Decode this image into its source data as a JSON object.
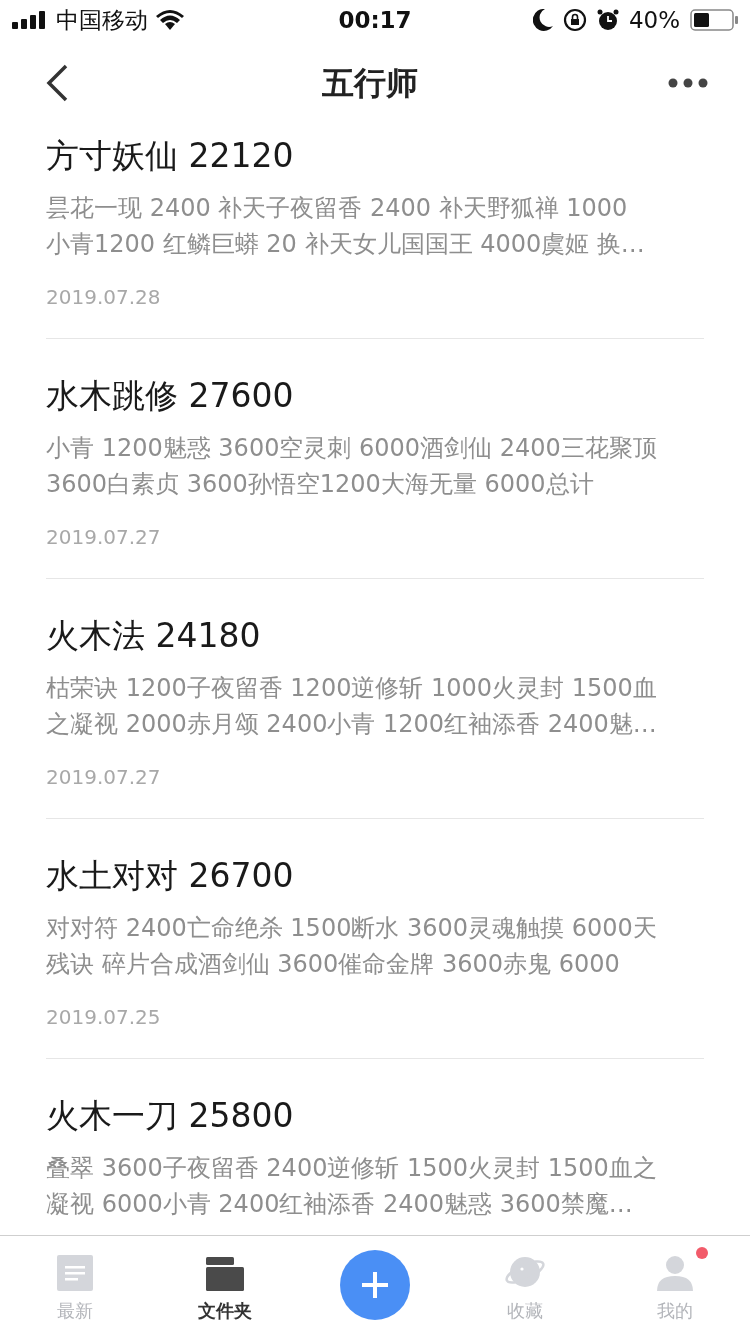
{
  "status_bar": {
    "carrier": "中国移动",
    "time": "00:17",
    "battery": "40%"
  },
  "nav": {
    "title": "五行师"
  },
  "notes": [
    {
      "title": "方寸妖仙 22120",
      "lines": [
        "昙花一现 2400 补天子夜留香 2400 补天野狐禅 1000",
        "小青1200 红鳞巨蟒 20 补天女儿国国王 4000虞姬 换…"
      ],
      "date": "2019.07.28"
    },
    {
      "title": "水木跳修 27600",
      "lines": [
        "小青 1200魅惑 3600空灵刺 6000酒剑仙 2400三花聚顶",
        "3600白素贞 3600孙悟空1200大海无量 6000总计"
      ],
      "date": "2019.07.27"
    },
    {
      "title": "火木法 24180",
      "lines": [
        "枯荣诀  1200子夜留香 1200逆修斩 1000火灵封 1500血",
        "之凝视 2000赤月颂 2400小青 1200红袖添香 2400魅…"
      ],
      "date": "2019.07.27"
    },
    {
      "title": "水土对对 26700",
      "lines": [
        "对对符 2400亡命绝杀 1500断水 3600灵魂触摸 6000天",
        "残诀 碎片合成酒剑仙 3600催命金牌 3600赤鬼 6000"
      ],
      "date": "2019.07.25"
    },
    {
      "title": "火木一刀 25800",
      "lines": [
        "叠翠 3600子夜留香 2400逆修斩 1500火灵封 1500血之",
        "凝视 6000小青 2400红袖添香 2400魅惑 3600禁魔…"
      ]
    }
  ],
  "tab_bar": [
    {
      "kind": "latest",
      "label": "最新",
      "selected": false,
      "badge": false
    },
    {
      "kind": "folder",
      "label": "文件夹",
      "selected": true,
      "badge": false
    },
    {
      "kind": "add"
    },
    {
      "kind": "favorites",
      "label": "收藏",
      "selected": false,
      "badge": false
    },
    {
      "kind": "me",
      "label": "我的",
      "selected": false,
      "badge": true
    }
  ]
}
